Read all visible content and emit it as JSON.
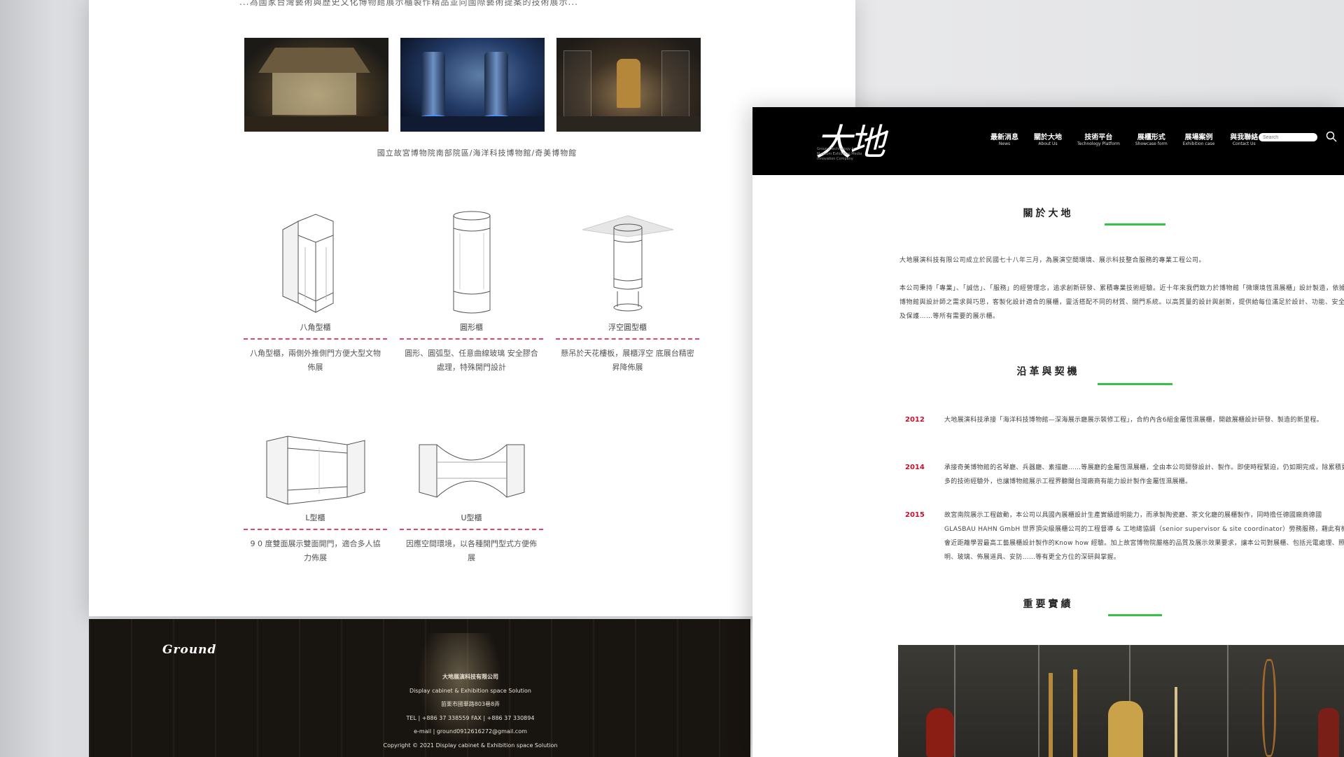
{
  "left": {
    "top_cut_text": "...為國家台灣藝術與歷史文化博物館展示櫃製作精品並向國際藝術提案的技術展示...",
    "photo_caption": "國立故宮博物院南部院區/海洋科技博物館/奇美博物館",
    "cabinets": [
      {
        "name": "八角型櫃",
        "desc": "八角型櫃，兩側外推側門方便大型文物佈展"
      },
      {
        "name": "圓形櫃",
        "desc": "圓形、圓弧型、任意曲線玻璃 安全膠合處理，特殊開門設計"
      },
      {
        "name": "浮空圓型櫃",
        "desc": "懸吊於天花樓板，展櫃浮空 底展台精密昇降佈展"
      },
      {
        "name": "L型櫃",
        "desc": "9 0 度雙面展示雙面開門，適合多人協力佈展"
      },
      {
        "name": "U型櫃",
        "desc": "因應空間環境，以各種開門型式方便佈展"
      }
    ],
    "footer": {
      "logo": "Ground",
      "lines": [
        "大地展演科技有限公司",
        "Display cabinet & Exhibition space Solution",
        "苗栗市國華路803巷8弄",
        "TEL | +886 37 338559 FAX | +886 37 330894",
        "e-mail | ground0912616272@gmail.com",
        "Copyright © 2021 Display cabinet & Exhibition space Solution"
      ]
    }
  },
  "right": {
    "brand": "大地",
    "brand_sub": "Ground Technology & Museum Exhibition Media Innovation Company",
    "nav": [
      {
        "zh": "最新消息",
        "en": "News"
      },
      {
        "zh": "關於大地",
        "en": "About Us"
      },
      {
        "zh": "技術平台",
        "en": "Technology Platform"
      },
      {
        "zh": "展櫃形式",
        "en": "Showcase form"
      },
      {
        "zh": "展場案例",
        "en": "Exhibition case"
      },
      {
        "zh": "與我聯絡",
        "en": "Contact Us"
      }
    ],
    "search_placeholder": "Search",
    "about_title": "關於大地",
    "about_p1": "大地展演科技有限公司成立於民國七十八年三月，為展演空間環境、展示科技整合服務的專業工程公司。",
    "about_p2": "本公司秉持「專業」、「誠信」、「服務」的經營理念，追求創新研發、累積專業技術經驗。近十年來我們致力於博物館「微環境恆濕展櫃」設計製造，依據博物館與設計師之需求與巧思，客製化設計適合的展櫃，靈活搭配不同的材質、開門系統。以高質量的設計與創新，提供給每位滿足於設計、功能、安全及保護……等所有需要的展示櫃。",
    "history_title": "沿革與契機",
    "history": [
      {
        "year": "2012",
        "text": "大地展演科技承接「海洋科技博物館—深海展示廳展示裝修工程」，合約內含6組金屬恆濕展櫃，開啟展櫃設計研發、製造的新里程。"
      },
      {
        "year": "2014",
        "text": "承接奇美博物館的名琴廳、兵器廳、素描廳……等展廳的金屬恆濕展櫃，全由本公司開發設計、製作。即使時程緊迫，仍如期完成，除累積更多的技術經驗外，也讓博物館展示工程界聽聞台灣廠商有能力設計製作金屬恆濕展櫃。"
      },
      {
        "year": "2015",
        "text": "故宮南院展示工程啟動，本公司以具國內展櫃設計生產實績證明能力，而承製陶瓷廳、茶文化廳的展櫃製作，同時擔任德國廠商德國GLASBAU HAHN GmbH 世界頂尖級展櫃公司的工程督導 & 工地總協調（senior supervisor & site coordinator）勞務服務，藉此有機會近距離學習最高工藝展櫃設計製作的Know how 經驗。加上故宮博物院嚴格的品質及展示效果要求，讓本公司對展櫃、包括光電處理、照明、玻璃、佈展道具、安防……等有更全方位的深研與掌握。"
      }
    ],
    "achieve_title": "重要實績"
  }
}
